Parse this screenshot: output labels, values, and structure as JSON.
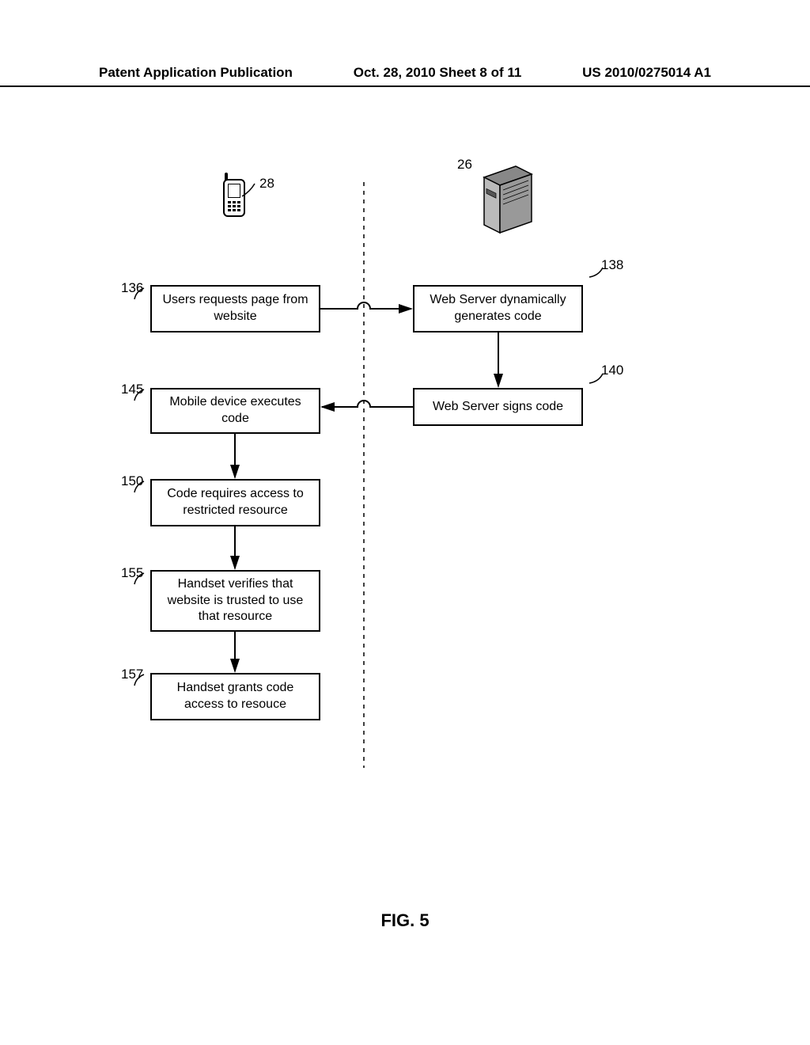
{
  "header": {
    "left": "Patent Application Publication",
    "center": "Oct. 28, 2010  Sheet 8 of 11",
    "right": "US 2010/0275014 A1"
  },
  "refs": {
    "r28": "28",
    "r26": "26",
    "r136": "136",
    "r138": "138",
    "r140": "140",
    "r145": "145",
    "r150": "150",
    "r155": "155",
    "r157": "157"
  },
  "boxes": {
    "b136": "Users requests page from website",
    "b138": "Web Server dynamically generates code",
    "b140": "Web Server signs code",
    "b145": "Mobile device executes code",
    "b150": "Code requires access to restricted resource",
    "b155": "Handset verifies that website is trusted to use that resource",
    "b157": "Handset grants code access to resouce"
  },
  "figure": "FIG. 5"
}
